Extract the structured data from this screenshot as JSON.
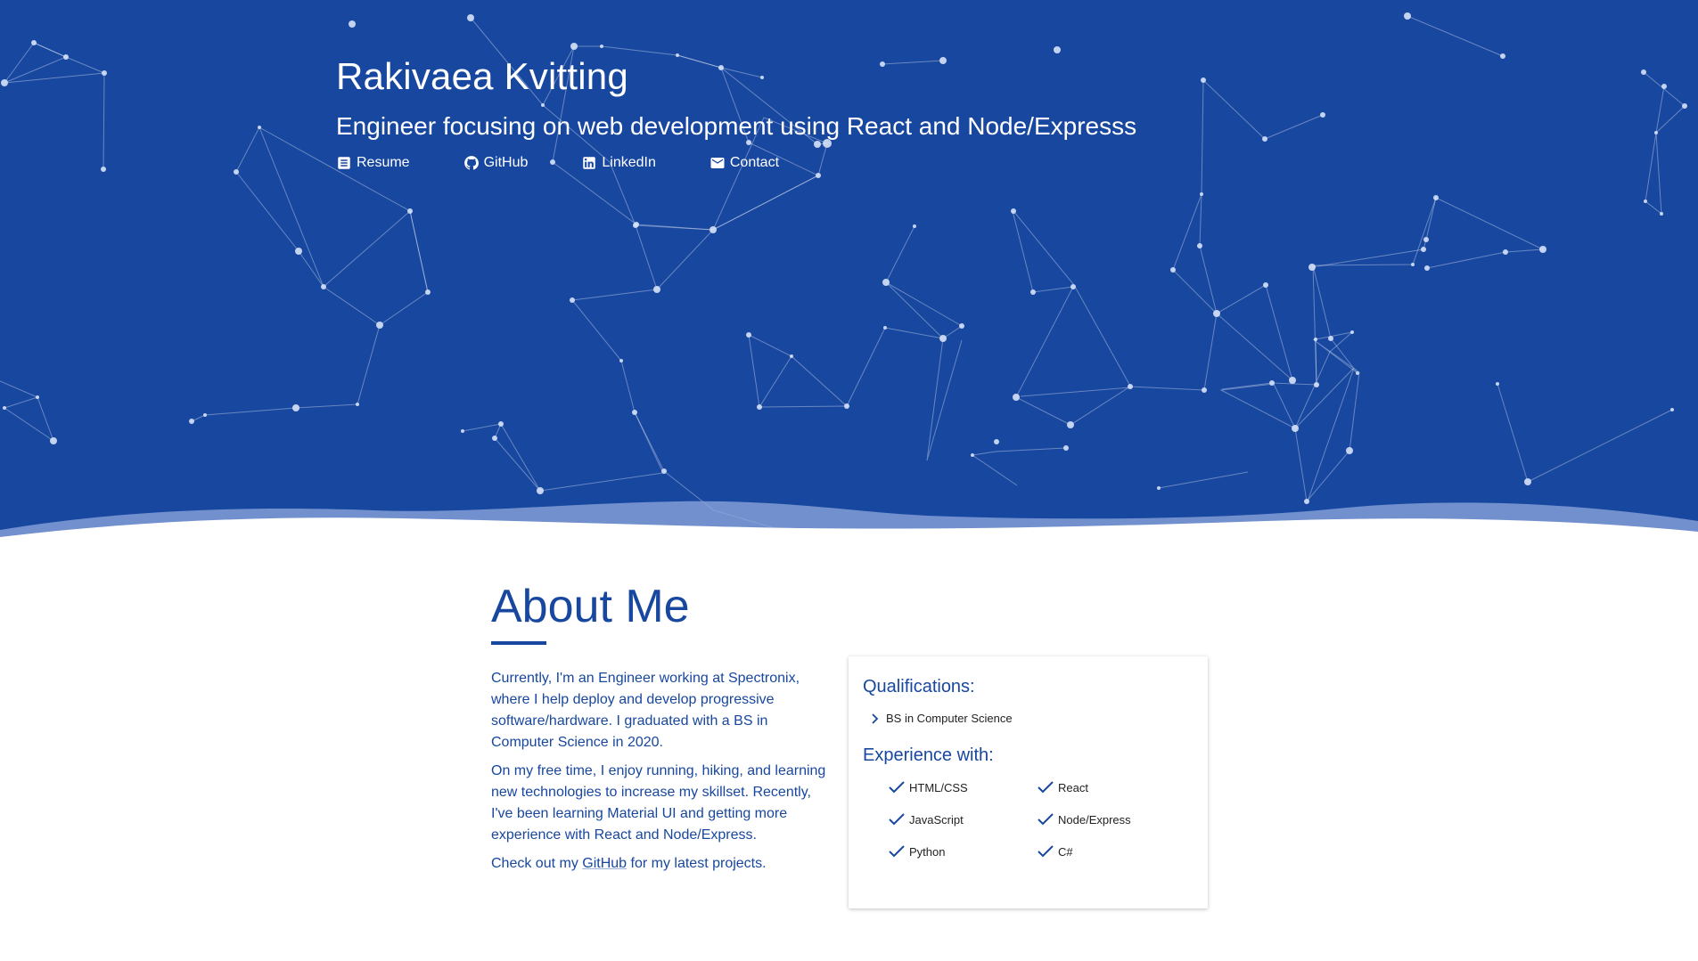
{
  "hero": {
    "name": "Rakivaea Kvitting",
    "tagline": "Engineer focusing on web development using React and Node/Expresss",
    "links": [
      {
        "label": "Resume",
        "icon": "description-icon"
      },
      {
        "label": "GitHub",
        "icon": "github-icon"
      },
      {
        "label": "LinkedIn",
        "icon": "linkedin-icon"
      },
      {
        "label": "Contact",
        "icon": "mail-icon"
      }
    ]
  },
  "about": {
    "title": "About Me",
    "paragraph1": "Currently, I'm an Engineer working at Spectronix, where I help deploy and develop progressive software/hardware. I graduated with a BS in Computer Science in 2020.",
    "paragraph2": "On my free time, I enjoy running, hiking, and learning new technologies to increase my skillset. Recently, I've been learning Material UI and getting more experience with React and Node/Express.",
    "paragraph3_prefix": "Check out my ",
    "paragraph3_link": "GitHub",
    "paragraph3_suffix": " for my latest projects."
  },
  "card": {
    "qualifications_heading": "Qualifications:",
    "qualifications": [
      "BS in Computer Science"
    ],
    "experience_heading": "Experience with:",
    "experience": [
      "HTML/CSS",
      "React",
      "JavaScript",
      "Node/Express",
      "Python",
      "C#"
    ]
  },
  "colors": {
    "primary": "#1847a0",
    "hero_bg": "#1847a0",
    "text_dark": "#222222",
    "background": "#ffffff"
  }
}
